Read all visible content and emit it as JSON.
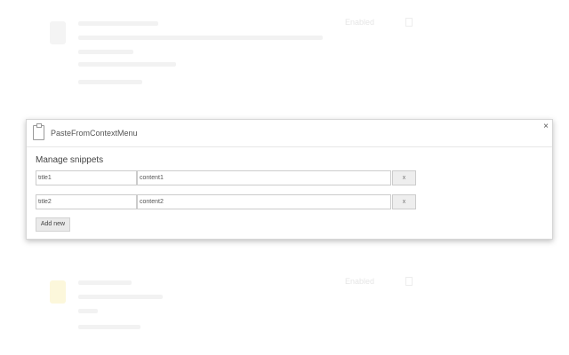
{
  "background_list": {
    "items": [
      {
        "status": "Enabled",
        "icon_color": "#eeeeee"
      },
      {
        "status": "Enabled",
        "icon_color": "#fbf3c8"
      }
    ]
  },
  "dialog": {
    "title": "PasteFromContextMenu",
    "close_label": "×",
    "section_title": "Manage snippets",
    "snippets": [
      {
        "title": "title1",
        "content": "content1",
        "delete_label": "x"
      },
      {
        "title": "title2",
        "content": "content2",
        "delete_label": "x"
      }
    ],
    "add_new_label": "Add new"
  }
}
